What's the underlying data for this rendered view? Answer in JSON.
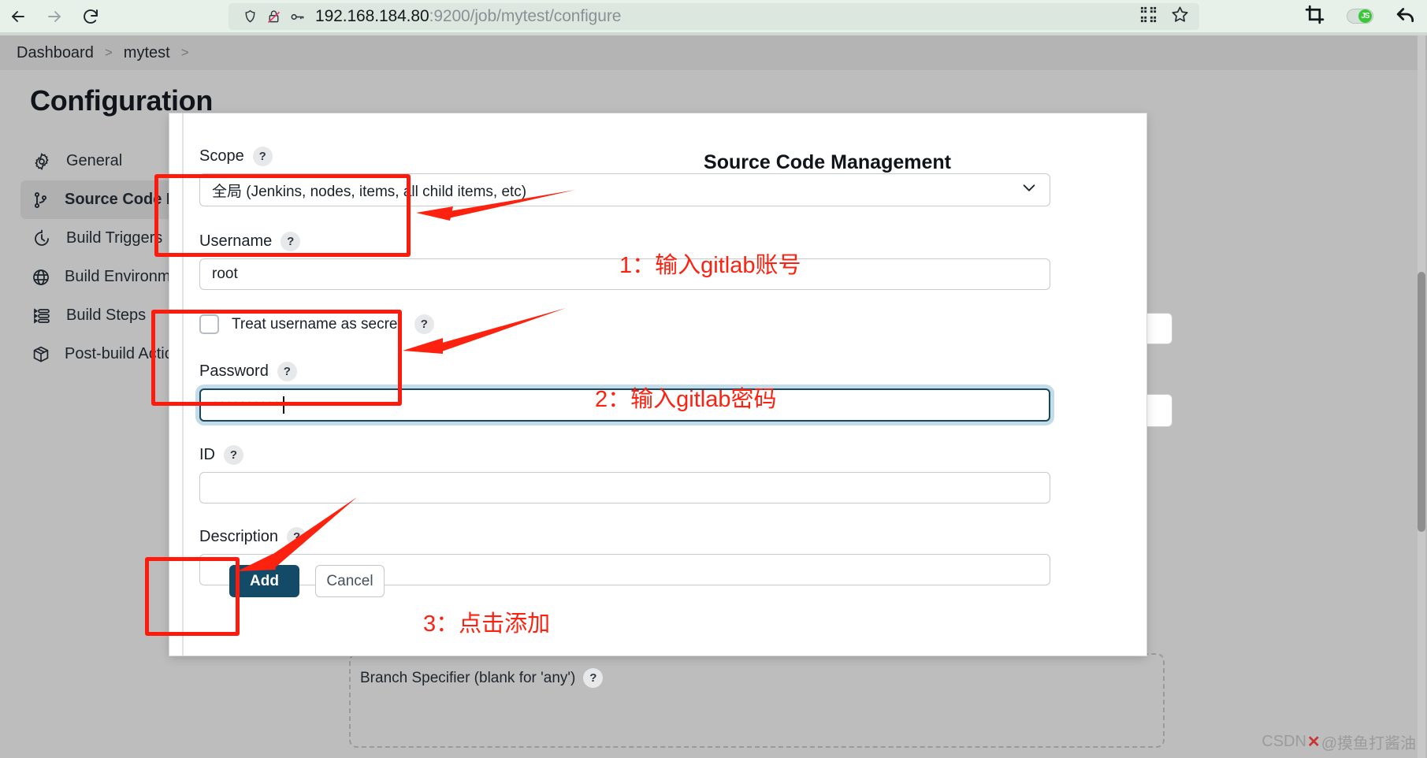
{
  "browser": {
    "back_icon": "arrow-left-icon",
    "forward_icon": "arrow-right-icon",
    "reload_icon": "reload-icon",
    "shield_icon": "shield-icon",
    "tracker_blocked_icon": "tracker-blocked-icon",
    "key_icon": "key-icon",
    "url_host": "192.168.184.80",
    "url_path": ":9200/job/mytest/configure",
    "url_full": "192.168.184.80:9200/job/mytest/configure",
    "qr_icon": "qr-code-icon",
    "bookmark_icon": "star-icon",
    "crop_icon": "crop-icon",
    "js_toggle_label": "JS",
    "undo_icon": "undo-arrow-icon"
  },
  "breadcrumb": {
    "items": [
      "Dashboard",
      "mytest"
    ],
    "separator": ">"
  },
  "page": {
    "title": "Configuration"
  },
  "sidebar": {
    "items": [
      {
        "label": "General",
        "icon": "gear-icon",
        "active": false
      },
      {
        "label": "Source Code Management",
        "icon": "git-branch-icon",
        "active": true
      },
      {
        "label": "Build Triggers",
        "icon": "clock-icon",
        "active": false
      },
      {
        "label": "Build Environment",
        "icon": "globe-icon",
        "active": false
      },
      {
        "label": "Build Steps",
        "icon": "list-icon",
        "active": false
      },
      {
        "label": "Post-build Actions",
        "icon": "package-icon",
        "active": false
      }
    ]
  },
  "modal": {
    "title": "Source Code Management",
    "scope": {
      "label": "Scope",
      "help": "?",
      "value": "全局 (Jenkins, nodes, items, all child items, etc)",
      "chevron": "chevron-down-icon"
    },
    "username": {
      "label": "Username",
      "help": "?",
      "value": "root",
      "placeholder": ""
    },
    "treat_as_secret": {
      "label": "Treat username as secret",
      "help": "?",
      "checked": false
    },
    "password": {
      "label": "Password",
      "help": "?",
      "value": "••••••••••",
      "focused": true
    },
    "id": {
      "label": "ID",
      "help": "?",
      "value": "",
      "placeholder": ""
    },
    "description": {
      "label": "Description",
      "help": "?",
      "value": "",
      "placeholder": ""
    },
    "add_button": "Add",
    "cancel_button": "Cancel"
  },
  "background": {
    "branch_specifier_label": "Branch Specifier (blank for 'any')",
    "branch_specifier_help": "?"
  },
  "annotations": [
    {
      "id": "1",
      "text": "1：输入gitlab账号"
    },
    {
      "id": "2",
      "text": "2：输入gitlab密码"
    },
    {
      "id": "3",
      "text": "3：点击添加"
    }
  ],
  "colors": {
    "annotation_red": "#fd2110",
    "primary_button": "#134a68",
    "focus_ring": "#c4dbe8",
    "active_sidebar": "#b0b0b0"
  },
  "watermark": {
    "prefix": "CSDN",
    "text": "@摸鱼打酱油"
  }
}
